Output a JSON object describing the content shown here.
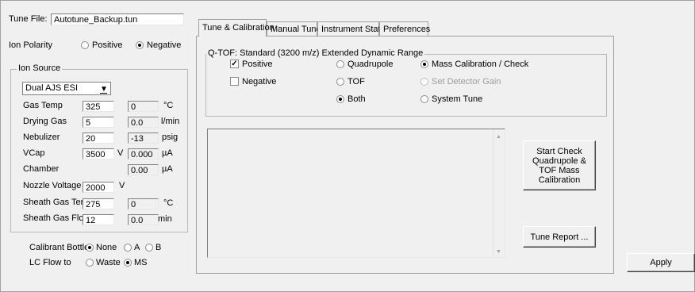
{
  "tune_file": {
    "label": "Tune File:",
    "value": "Autotune_Backup.tun"
  },
  "ion_polarity": {
    "label": "Ion Polarity",
    "positive": "Positive",
    "negative": "Negative",
    "selected": "Negative"
  },
  "ion_source": {
    "title": "Ion Source",
    "source_select": "Dual AJS ESI",
    "rows": [
      {
        "label": "Gas Temp",
        "setpoint": "325",
        "unit_sp": "",
        "actual": "0",
        "unit": "°C"
      },
      {
        "label": "Drying Gas",
        "setpoint": "5",
        "unit_sp": "",
        "actual": "0.0",
        "unit": "l/min"
      },
      {
        "label": "Nebulizer",
        "setpoint": "20",
        "unit_sp": "",
        "actual": "-13",
        "unit": "psig"
      },
      {
        "label": "VCap",
        "setpoint": "3500",
        "unit_sp": "V",
        "actual": "0.000",
        "unit": "µA"
      },
      {
        "label": "Chamber",
        "setpoint": "",
        "unit_sp": "",
        "actual": "0.00",
        "unit": "µA"
      },
      {
        "label": "Nozzle Voltage",
        "setpoint": "2000",
        "unit_sp": "V",
        "actual": "",
        "unit": ""
      },
      {
        "label": "Sheath Gas Temp",
        "setpoint": "275",
        "unit_sp": "",
        "actual": "0",
        "unit": "°C"
      },
      {
        "label": "Sheath Gas Flow",
        "setpoint": "12",
        "unit_sp": "",
        "actual": "0.0",
        "unit": "min"
      }
    ]
  },
  "calibrant_bottle": {
    "label": "Calibrant Bottle",
    "options": [
      "None",
      "A",
      "B"
    ],
    "selected": "None"
  },
  "lc_flow": {
    "label": "LC Flow to",
    "options": [
      "Waste",
      "MS"
    ],
    "selected": "MS"
  },
  "tabs": [
    {
      "label": "Tune & Calibration",
      "active": true
    },
    {
      "label": "Manual Tune",
      "active": false
    },
    {
      "label": "Instrument State",
      "active": false
    },
    {
      "label": "Preferences",
      "active": false
    }
  ],
  "qtof": {
    "title": "Q-TOF:  Standard (3200 m/z) Extended Dynamic Range",
    "positive": "Positive",
    "negative": "Negative",
    "positive_checked": true,
    "negative_checked": false,
    "quadrupole": "Quadrupole",
    "tof": "TOF",
    "both": "Both",
    "mass_calibration": "Mass Calibration / Check",
    "set_detector_gain": "Set Detector Gain",
    "system_tune": "System Tune"
  },
  "buttons": {
    "start_check": "Start Check Quadrupole & TOF Mass Calibration",
    "tune_report": "Tune Report ...",
    "apply": "Apply"
  }
}
